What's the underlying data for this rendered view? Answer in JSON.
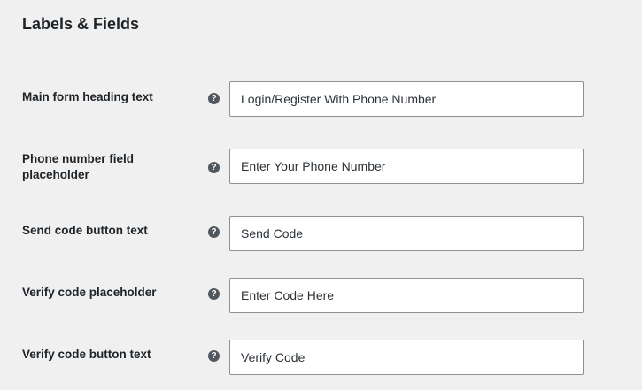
{
  "section": {
    "title": "Labels & Fields"
  },
  "fields": [
    {
      "label": "Main form heading text",
      "value": "Login/Register With Phone Number",
      "help_glyph": "?"
    },
    {
      "label": "Phone number field placeholder",
      "value": "Enter Your Phone Number",
      "help_glyph": "?"
    },
    {
      "label": "Send code button text",
      "value": "Send Code",
      "help_glyph": "?"
    },
    {
      "label": "Verify code placeholder",
      "value": "Enter Code Here",
      "help_glyph": "?"
    },
    {
      "label": "Verify code button text",
      "value": "Verify Code",
      "help_glyph": "?"
    }
  ],
  "icons": {
    "help": "help-question-icon"
  },
  "colors": {
    "page_background": "#f0f0f1",
    "input_border": "#8c8f94",
    "help_icon": "#50575e",
    "text": "#1d2327"
  }
}
